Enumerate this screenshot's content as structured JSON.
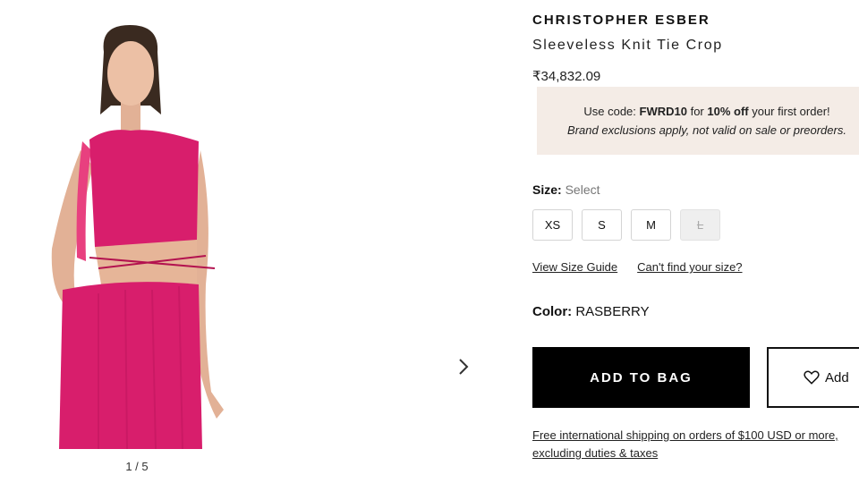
{
  "gallery": {
    "counter": "1 / 5",
    "icons": {
      "next": "chevron-right-icon"
    }
  },
  "product": {
    "brand": "CHRISTOPHER ESBER",
    "name": "Sleeveless Knit Tie Crop",
    "price": "₹34,832.09",
    "promo": {
      "prefix": "Use code: ",
      "code": "FWRD10",
      "middle": " for ",
      "discount": "10% off",
      "suffix": " your first order!",
      "note": "Brand exclusions apply, not valid on sale or preorders."
    },
    "size": {
      "label": "Size:",
      "value": "Select",
      "options": [
        "XS",
        "S",
        "M",
        "L"
      ],
      "unavailable": [
        "L"
      ]
    },
    "links": {
      "size_guide": "View Size Guide",
      "cant_find": "Can't find your size?"
    },
    "color": {
      "label": "Color:",
      "value": "RASBERRY"
    },
    "add_to_bag": "ADD TO BAG",
    "wishlist": "Add",
    "shipping": "Free international shipping on orders of $100 USD or more, excluding duties & taxes"
  },
  "colors": {
    "garment": "#d81e6c",
    "promo_bg": "#f4ece6",
    "button": "#000000"
  }
}
